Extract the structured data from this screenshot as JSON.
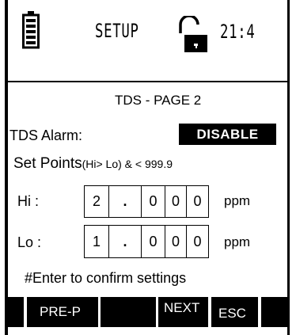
{
  "header": {
    "title": "SETUP",
    "time": "21:4",
    "icons": [
      "battery-icon",
      "unlocked-padlock-icon"
    ]
  },
  "page_title": "TDS - PAGE 2",
  "alarm": {
    "label": "TDS Alarm:",
    "value": "DISABLE"
  },
  "setpoints": {
    "label": "Set Points",
    "hint": "(Hi> Lo) & < 999.9",
    "hi": {
      "label": "Hi :",
      "digits": [
        "2",
        ".",
        "0",
        "0",
        "0"
      ],
      "unit": "ppm"
    },
    "lo": {
      "label": "Lo :",
      "digits": [
        "1",
        ".",
        "0",
        "0",
        "0"
      ],
      "unit": "ppm"
    }
  },
  "instruction": "#Enter to confirm settings",
  "softkeys": {
    "k1": "PRE-P",
    "k2": "",
    "k3": "NEXT",
    "k4": "ESC"
  }
}
